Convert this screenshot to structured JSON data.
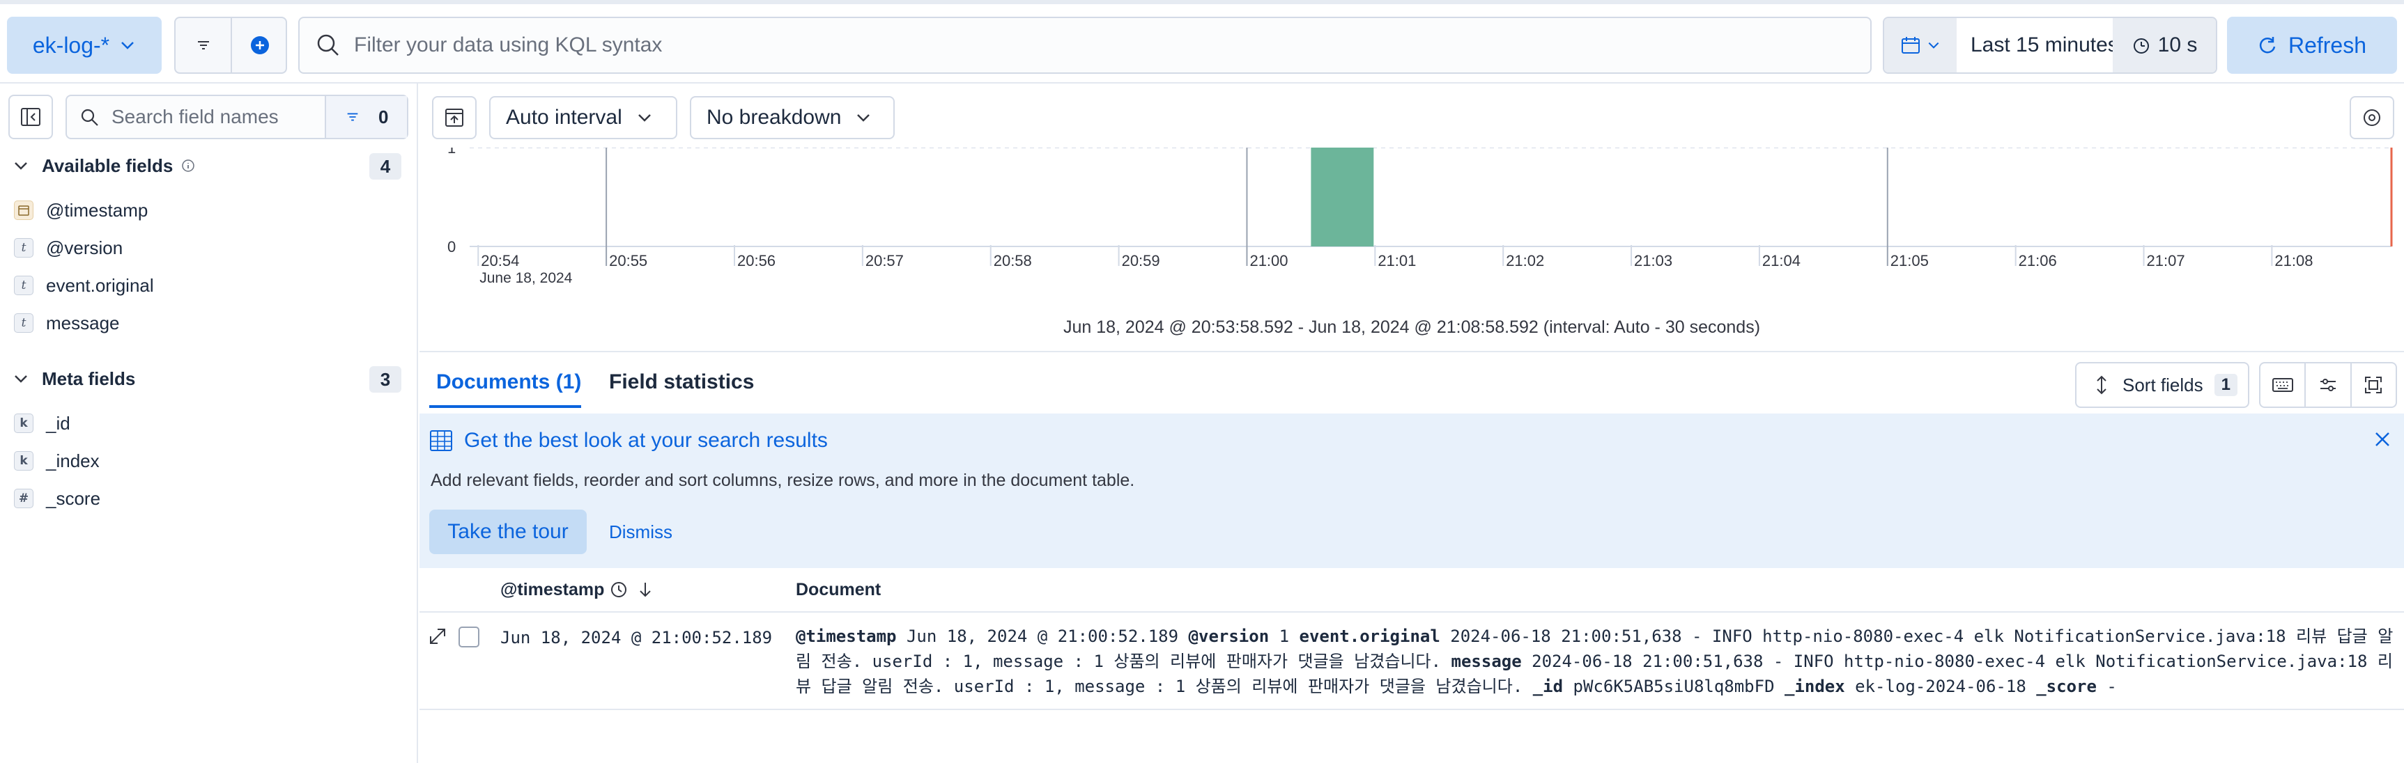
{
  "topbar": {
    "data_view": "ek-log-*",
    "search_placeholder": "Filter your data using KQL syntax",
    "time_range": "Last 15 minutes",
    "auto_refresh": "10 s",
    "refresh_label": "Refresh"
  },
  "sidebar": {
    "search_placeholder": "Search field names",
    "filter_count": "0",
    "available": {
      "label": "Available fields",
      "count": "4",
      "fields": [
        {
          "type": "date",
          "name": "@timestamp"
        },
        {
          "type": "t",
          "name": "@version"
        },
        {
          "type": "t",
          "name": "event.original"
        },
        {
          "type": "t",
          "name": "message"
        }
      ]
    },
    "meta": {
      "label": "Meta fields",
      "count": "3",
      "fields": [
        {
          "type": "k",
          "name": "_id"
        },
        {
          "type": "k",
          "name": "_index"
        },
        {
          "type": "#",
          "name": "_score"
        }
      ]
    }
  },
  "chart_toolbar": {
    "interval": "Auto interval",
    "breakdown": "No breakdown"
  },
  "chart_data": {
    "type": "bar",
    "y_ticks": [
      "1",
      "0"
    ],
    "ylim": [
      0,
      1
    ],
    "x_ticks": [
      "20:54",
      "20:55",
      "20:56",
      "20:57",
      "20:58",
      "20:59",
      "21:00",
      "21:01",
      "21:02",
      "21:03",
      "21:04",
      "21:05",
      "21:06",
      "21:07",
      "21:08"
    ],
    "x_subtitle": "June 18, 2024",
    "bars": [
      {
        "start": "21:00:30",
        "end": "21:01:00",
        "value": 1
      }
    ],
    "bar_color": "#6cb59a"
  },
  "range_text": "Jun 18, 2024 @ 20:53:58.592 - Jun 18, 2024 @ 21:08:58.592 (interval: Auto - 30 seconds)",
  "tabs": {
    "documents": "Documents (1)",
    "field_stats": "Field statistics"
  },
  "sort": {
    "label": "Sort fields",
    "count": "1"
  },
  "callout": {
    "title": "Get the best look at your search results",
    "body": "Add relevant fields, reorder and sort columns, resize rows, and more in the document table.",
    "tour": "Take the tour",
    "dismiss": "Dismiss"
  },
  "table": {
    "col_timestamp": "@timestamp",
    "col_document": "Document",
    "row_timestamp": "Jun 18, 2024 @ 21:00:52.189",
    "doc": {
      "k_timestamp": "@timestamp",
      "v_timestamp": "Jun 18, 2024 @ 21:00:52.189",
      "k_version": "@version",
      "v_version": "1",
      "k_event": "event.original",
      "v_event_a": "2024-06-18 21:00:51,638 - INFO http-nio-8080-exec-4 elk NotificationService.java:18 리뷰 답글 알",
      "v_event_b": "림 전송. userId : 1, message : 1 상품의 리뷰에 판매자가 댓글을 남겼습니다.",
      "k_message": "message",
      "v_message_a": "2024-06-18 21:00:51,638 - INFO http-nio-8080-exec-4 elk NotificationService.java:18 리",
      "v_message_b": "뷰 답글 알림 전송. userId : 1, message : 1 상품의 리뷰에 판매자가 댓글을 남겼습니다.",
      "k_id": "_id",
      "v_id": "pWc6K5AB5siU8lq8mbFD",
      "k_index": "_index",
      "v_index": "ek-log-2024-06-18",
      "k_score": "_score",
      "v_score": "-"
    }
  }
}
